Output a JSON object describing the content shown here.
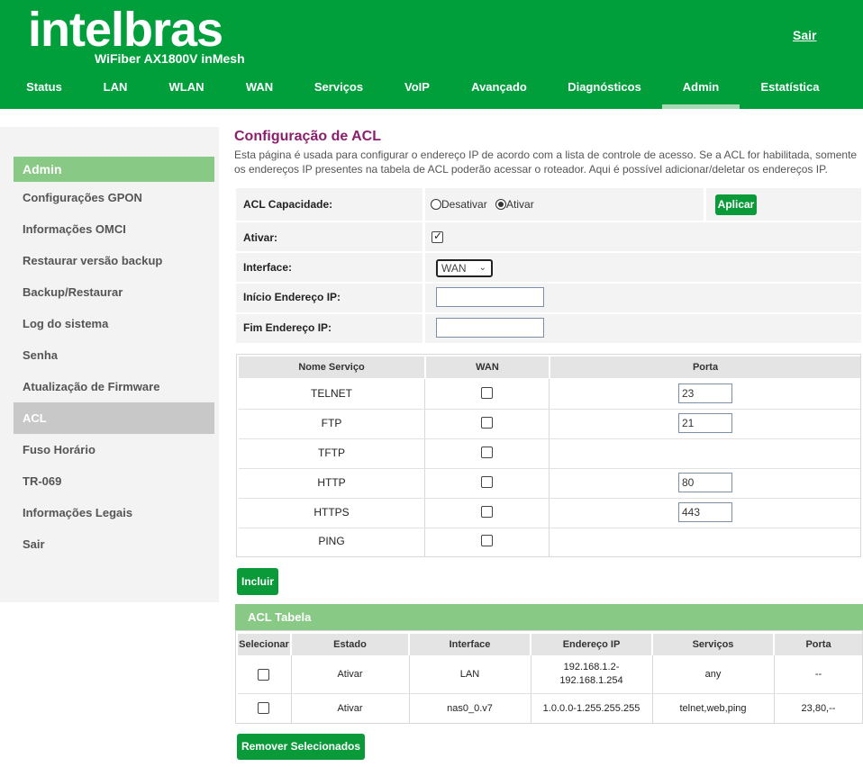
{
  "header": {
    "logo": "intelbras",
    "model": "WiFiber AX1800V inMesh",
    "logout": "Sair",
    "nav": [
      "Status",
      "LAN",
      "WLAN",
      "WAN",
      "Serviços",
      "VoIP",
      "Avançado",
      "Diagnósticos",
      "Admin",
      "Estatística"
    ],
    "active_nav": "Admin"
  },
  "sidebar": {
    "title": "Admin",
    "items": [
      "Configurações GPON",
      "Informações OMCI",
      "Restaurar versão backup",
      "Backup/Restaurar",
      "Log do sistema",
      "Senha",
      "Atualização de Firmware",
      "ACL",
      "Fuso Horário",
      "TR-069",
      "Informações Legais",
      "Sair"
    ],
    "active_item": "ACL"
  },
  "main": {
    "title": "Configuração de ACL",
    "description": "Esta página é usada para configurar o endereço IP de acordo com a lista de controle de acesso. Se a ACL for habilitada, somente os endereços IP presentes na tabela de ACL poderão acessar o roteador. Aqui é possível adicionar/deletar os endereços IP.",
    "config": {
      "capacity_label": "ACL Capacidade:",
      "radio_disable": "Desativar",
      "radio_enable": "Ativar",
      "radio_selected": "Ativar",
      "apply_button": "Aplicar",
      "enable_label": "Ativar:",
      "enable_checked": true,
      "interface_label": "Interface:",
      "interface_value": "WAN",
      "start_ip_label": "Início Endereço IP:",
      "start_ip_value": "",
      "end_ip_label": "Fim Endereço IP:",
      "end_ip_value": ""
    },
    "services_table": {
      "headers": [
        "Nome Serviço",
        "WAN",
        "Porta"
      ],
      "rows": [
        {
          "name": "TELNET",
          "wan": false,
          "port": "23"
        },
        {
          "name": "FTP",
          "wan": false,
          "port": "21"
        },
        {
          "name": "TFTP",
          "wan": false,
          "port": null
        },
        {
          "name": "HTTP",
          "wan": false,
          "port": "80"
        },
        {
          "name": "HTTPS",
          "wan": false,
          "port": "443"
        },
        {
          "name": "PING",
          "wan": false,
          "port": null
        }
      ]
    },
    "add_button": "Incluir",
    "acl_table": {
      "title": "ACL Tabela",
      "headers": [
        "Selecionar",
        "Estado",
        "Interface",
        "Endereço IP",
        "Serviços",
        "Porta"
      ],
      "rows": [
        {
          "estado": "Ativar",
          "interface": "LAN",
          "ip_line1": "192.168.1.2-",
          "ip_line2": "192.168.1.254",
          "servicos": "any",
          "porta": "--"
        },
        {
          "estado": "Ativar",
          "interface": "nas0_0.v7",
          "ip_line1": "1.0.0.0-1.255.255.255",
          "ip_line2": "",
          "servicos": "telnet,web,ping",
          "porta": "23,80,--"
        }
      ]
    },
    "remove_button": "Remover Selecionados"
  },
  "colors": {
    "brand_green": "#009f3c",
    "light_green": "#88c986",
    "title_purple": "#8a1f6e"
  }
}
